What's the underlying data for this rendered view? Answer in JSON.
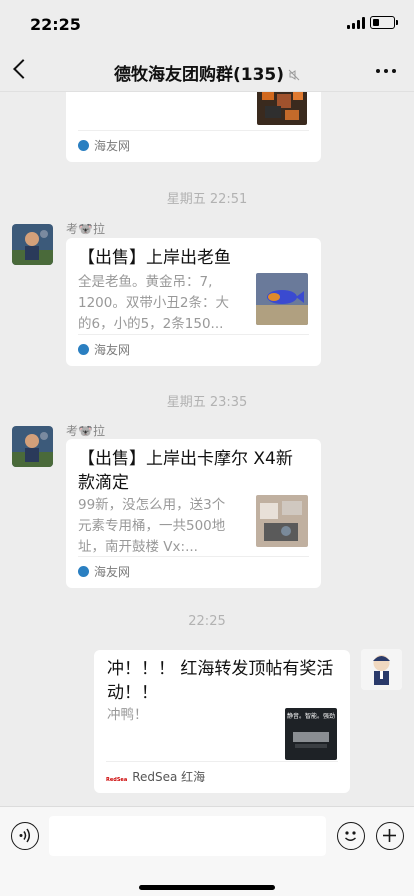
{
  "status_bar": {
    "time": "22:25",
    "battery_level": 0.3
  },
  "header": {
    "title": "德牧海友团购群(135)"
  },
  "messages": [
    {
      "source": "海友网"
    },
    {
      "timestamp": "星期五 22:51",
      "sender": "考🐨拉",
      "title": "【出售】上岸出老鱼",
      "desc_lines": [
        "全是老鱼。黄金吊：7,",
        "1200。双带小丑2条：大",
        "的6，小的5，2条150..."
      ],
      "source": "海友网"
    },
    {
      "timestamp": "星期五 23:35",
      "sender": "考🐨拉",
      "title_lines": [
        "【出售】上岸出卡摩尔 X4新",
        "款滴定"
      ],
      "desc_lines": [
        "99新，没怎么用，送3个",
        "元素专用桶，一共500地",
        "址，南开鼓楼 Vx:..."
      ],
      "source": "海友网"
    },
    {
      "timestamp": "22:25",
      "title_lines": [
        "冲！！！ 红海转发顶帖有奖活",
        "动！！"
      ],
      "desc": "冲鸭！",
      "source": "RedSea 红海",
      "source_logo": "RedSea",
      "thumb_text": "静音。智能。强劲"
    }
  ],
  "colors": {
    "background": "#ededed",
    "card": "#ffffff",
    "timestamp": "#b2b2b2",
    "source_icon": "#2a7fc1"
  }
}
